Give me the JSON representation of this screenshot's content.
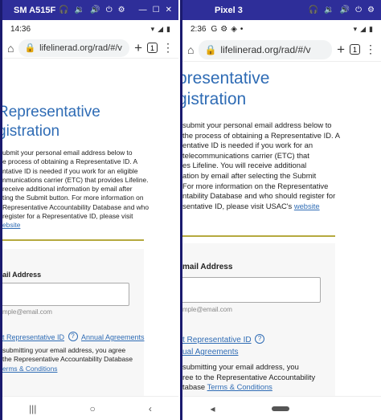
{
  "left_device": {
    "window_title": "SM A515F",
    "status_time": "14:36",
    "url": "lifelinerad.org/rad/#/v",
    "heading_lines": [
      "Representative",
      "gistration"
    ],
    "paragraph_lines": [
      "ubmit your personal email address below to",
      "e process of obtaining a Representative ID. A",
      "ntative ID is needed if you work for an eligible",
      "nmunications carrier (ETC) that provides Lifeline.",
      "receive additional information by email after",
      "ting the Submit button. For more information on",
      "Representative Accountability Database and who",
      "register for a Representative ID, please visit"
    ],
    "paragraph_link": "ebsite",
    "email_label": "ail Address",
    "email_placeholder": "mple@email.com",
    "help_link": "t Representative ID",
    "help_mark": "?",
    "annual_link": "Annual Agreements",
    "agree_lines": [
      "submitting your email address, you agree",
      "the Representative Accountability Database"
    ],
    "terms_link": "erms & Conditions"
  },
  "right_device": {
    "window_title": "Pixel 3",
    "status_time": "2:36",
    "url": "lifelinerad.org/rad/#/v",
    "heading_lines": [
      "presentative",
      "gistration"
    ],
    "paragraph_lines": [
      "submit your personal email address below to",
      "the process of obtaining a Representative ID. A",
      "entative ID is needed if you work for an",
      "telecommunications carrier (ETC) that",
      "es Lifeline. You will receive additional",
      "ation by email after selecting the Submit",
      "For more information on the Representative",
      "ntability Database and who should register for",
      "sentative ID, please visit USAC's "
    ],
    "paragraph_link": "website",
    "email_label": "mail Address",
    "email_placeholder": "mple@email.com",
    "help_link": "t Representative ID",
    "help_mark": "?",
    "annual_link": "ual Agreements",
    "agree_lines": [
      "submitting your email address, you",
      "ree to the Representative Accountability"
    ],
    "terms_prefix": "tabase ",
    "terms_link": "Terms & Conditions"
  }
}
